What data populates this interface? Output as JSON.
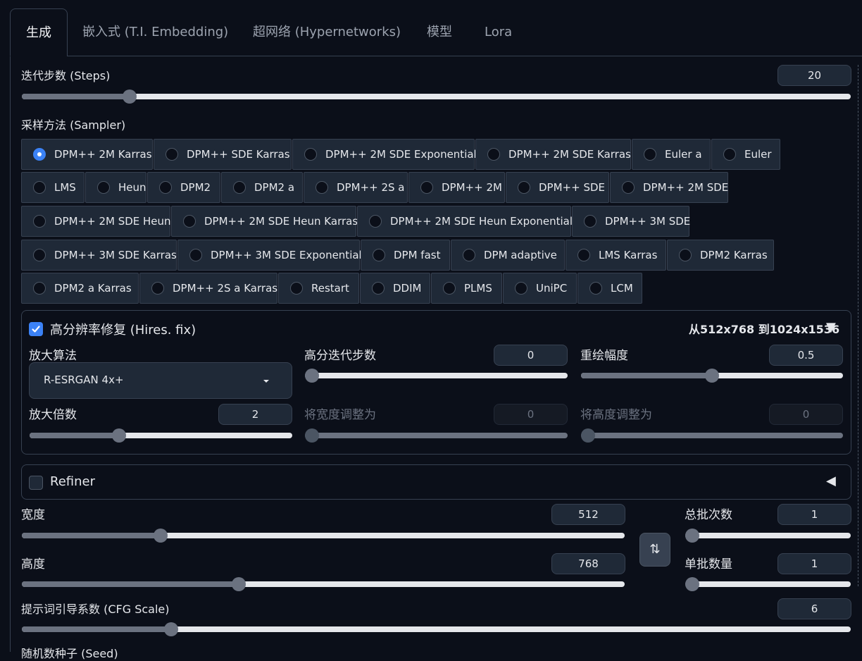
{
  "tabs": [
    {
      "label": "生成",
      "active": true
    },
    {
      "label": "嵌入式 (T.I. Embedding)"
    },
    {
      "label": "超网络 (Hypernetworks)"
    },
    {
      "label": "模型"
    },
    {
      "label": "Lora"
    }
  ],
  "steps": {
    "label": "迭代步数 (Steps)",
    "value": "20",
    "fraction": 0.13
  },
  "sampler": {
    "label": "采样方法 (Sampler)",
    "selected": "DPM++ 2M Karras",
    "rows": [
      [
        "DPM++ 2M Karras",
        "DPM++ SDE Karras",
        "DPM++ 2M SDE Exponential",
        "DPM++ 2M SDE Karras",
        "Euler a",
        "Euler"
      ],
      [
        "LMS",
        "Heun",
        "DPM2",
        "DPM2 a",
        "DPM++ 2S a",
        "DPM++ 2M",
        "DPM++ SDE",
        "DPM++ 2M SDE"
      ],
      [
        "DPM++ 2M SDE Heun",
        "DPM++ 2M SDE Heun Karras",
        "DPM++ 2M SDE Heun Exponential",
        "DPM++ 3M SDE"
      ],
      [
        "DPM++ 3M SDE Karras",
        "DPM++ 3M SDE Exponential",
        "DPM fast",
        "DPM adaptive",
        "LMS Karras",
        "DPM2 Karras"
      ],
      [
        "DPM2 a Karras",
        "DPM++ 2S a Karras",
        "Restart",
        "DDIM",
        "PLMS",
        "UniPC",
        "LCM"
      ]
    ]
  },
  "hires": {
    "title": "高分辨率修复 (Hires. fix)",
    "checked": true,
    "resolution_text": "从512x768 到1024x1536",
    "collapse_symbol": "▼",
    "upscaler_label": "放大算法",
    "upscaler_value": "R-ESRGAN 4x+",
    "hires_steps_label": "高分迭代步数",
    "hires_steps_value": "0",
    "hires_steps_fraction": 0.0,
    "denoise_label": "重绘幅度",
    "denoise_value": "0.5",
    "denoise_fraction": 0.5,
    "scale_label": "放大倍数",
    "scale_value": "2",
    "scale_fraction": 0.34,
    "resize_w_label": "将宽度调整为",
    "resize_w_value": "0",
    "resize_h_label": "将高度调整为",
    "resize_h_value": "0"
  },
  "refiner": {
    "title": "Refiner",
    "checked": false,
    "collapse_symbol": "◀"
  },
  "width": {
    "label": "宽度",
    "value": "512",
    "fraction": 0.23
  },
  "height": {
    "label": "高度",
    "value": "768",
    "fraction": 0.36
  },
  "batch_count": {
    "label": "总批次数",
    "value": "1",
    "fraction": 0.0
  },
  "batch_size": {
    "label": "单批数量",
    "value": "1",
    "fraction": 0.0
  },
  "swap_symbol": "⇅",
  "cfg": {
    "label": "提示词引导系数 (CFG Scale)",
    "value": "6",
    "fraction": 0.18
  },
  "seed": {
    "label": "随机数种子 (Seed)"
  },
  "colors": {
    "accent": "#3b82f6",
    "background": "#0b0f19",
    "surface": "#1f2937",
    "border": "#374151"
  }
}
